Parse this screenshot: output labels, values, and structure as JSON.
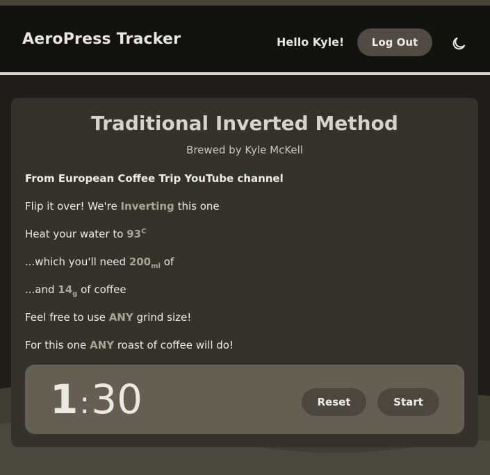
{
  "header": {
    "brand": "AeroPress Tracker",
    "greeting": "Hello Kyle!",
    "logout_label": "Log Out",
    "theme_icon": "moon-icon"
  },
  "recipe": {
    "title": "Traditional Inverted Method",
    "byline": "Brewed by Kyle McKell",
    "source": "From European Coffee Trip YouTube channel",
    "invert": {
      "prefix": "Flip it over! We're ",
      "value": "Inverting",
      "suffix": " this one"
    },
    "water_temp": {
      "prefix": "Heat your water to ",
      "value": "93",
      "unit": "C"
    },
    "water_amount": {
      "prefix": "...which you'll need ",
      "value": "200",
      "unit": "ml",
      "suffix": " of"
    },
    "coffee_amount": {
      "prefix": "...and ",
      "value": "14",
      "unit": "g",
      "suffix": " of coffee"
    },
    "grind": {
      "prefix": "Feel free to use ",
      "value": "ANY",
      "suffix": " grind size!"
    },
    "roast": {
      "prefix": "For this one ",
      "value": "ANY",
      "suffix": " roast of coffee will do!"
    }
  },
  "timer": {
    "minutes": "1",
    "separator": ":",
    "seconds": "30",
    "reset_label": "Reset",
    "start_label": "Start"
  },
  "colors": {
    "background": "#1e1d1a",
    "navbar": "#121210",
    "card": "#33322b",
    "timer_panel": "#655f53",
    "button": "#4f4b42",
    "highlight": "#a9a595"
  }
}
